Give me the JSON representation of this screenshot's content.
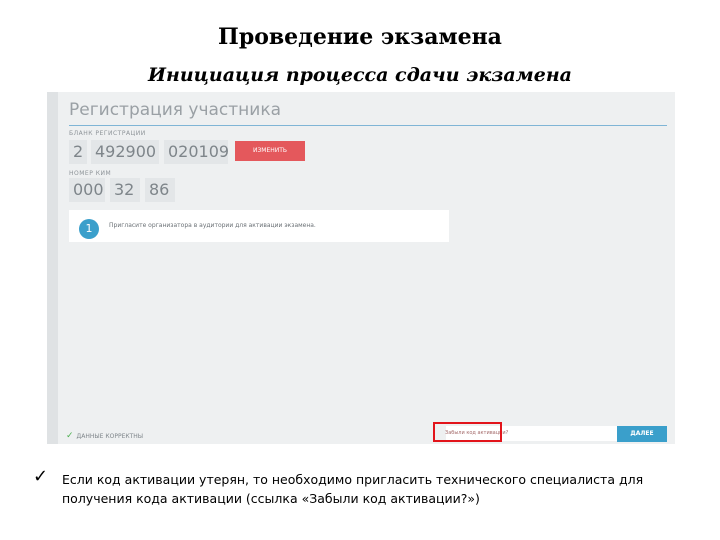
{
  "slide": {
    "title": "Проведение экзамена",
    "subtitle": "Инициация процесса сдачи экзамена"
  },
  "app": {
    "title": "Регистрация участника",
    "blank_label": "Бланк регистрации",
    "blank_code": [
      "2",
      "492900",
      "020109"
    ],
    "change_button": "ИЗМЕНИТЬ",
    "kim_label": "Номер КИМ",
    "kim_code": [
      "000",
      "32",
      "86"
    ],
    "step_number": "1",
    "step_text": "Пригласите организатора в аудитории для активации экзамена.",
    "status_text": "Данные корректны",
    "activation_placeholder": "Забыли код активации?",
    "next_button": "ДАЛЕЕ",
    "accent_color": "#3a9fcb",
    "danger_color": "#e4585c"
  },
  "note": {
    "icon": "check-icon",
    "text": "Если код активации утерян, то необходимо пригласить технического специалиста для получения кода активации (ссылка «Забыли код активации?»)"
  }
}
